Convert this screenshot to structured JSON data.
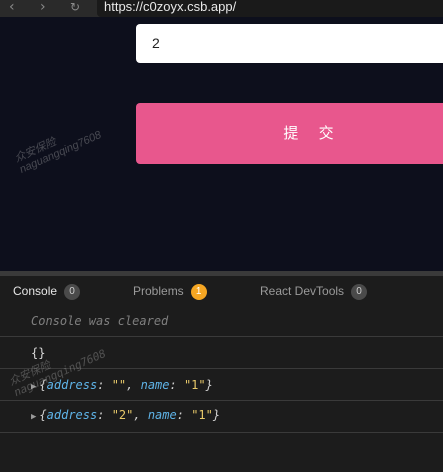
{
  "browser": {
    "back_icon": "chevron-left-icon",
    "forward_icon": "chevron-right-icon",
    "reload_icon": "reload-icon",
    "url": "https://c0zoyx.csb.app/"
  },
  "preview": {
    "input_value": "2",
    "submit_label": "提 交",
    "watermark_lines": [
      "众安保险",
      "naguangqing7608"
    ],
    "colors": {
      "background": "#0d0f1c",
      "submit": "#e8578d"
    }
  },
  "devtools": {
    "tabs": [
      {
        "label": "Console",
        "count": "0"
      },
      {
        "label": "Problems",
        "count": "1"
      },
      {
        "label": "React DevTools",
        "count": "0"
      }
    ],
    "console": {
      "cleared_message": "Console was cleared",
      "empty_object": "{}",
      "entries": [
        {
          "address_key": "address",
          "address_value": "\"\"",
          "name_key": "name",
          "name_value": "\"1\""
        },
        {
          "address_key": "address",
          "address_value": "\"2\"",
          "name_key": "name",
          "name_value": "\"1\""
        }
      ]
    }
  }
}
